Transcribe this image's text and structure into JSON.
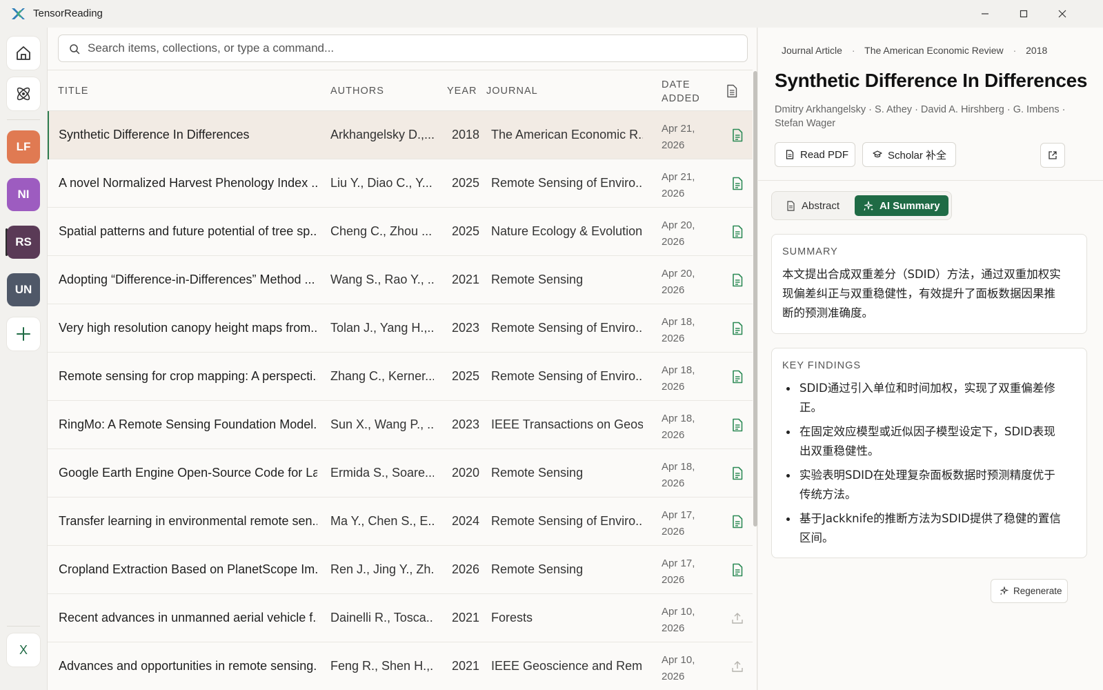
{
  "app": {
    "title": "TensorReading"
  },
  "window_controls": {
    "minimize": "minimize-icon",
    "maximize": "maximize-icon",
    "close": "close-icon"
  },
  "rail": {
    "home_icon": "home-icon",
    "atom_icon": "atom-icon",
    "libraries": [
      {
        "initials": "LF",
        "color": "#e07a52"
      },
      {
        "initials": "NI",
        "color": "#9d5cc0"
      },
      {
        "initials": "RS",
        "color": "#5a3a56",
        "active": true
      },
      {
        "initials": "UN",
        "color": "#4f5868"
      }
    ],
    "add_icon": "plus-icon",
    "bottom_label": "X"
  },
  "search": {
    "placeholder": "Search items, collections, or type a command..."
  },
  "table": {
    "headers": {
      "title": "TITLE",
      "authors": "AUTHORS",
      "year": "YEAR",
      "journal": "JOURNAL",
      "date_added_1": "DATE",
      "date_added_2": "ADDED"
    },
    "rows": [
      {
        "title": "Synthetic Difference In Differences",
        "authors": "Arkhangelsky D.,...",
        "year": "2018",
        "journal": "The American Economic R...",
        "date1": "Apr 21,",
        "date2": "2026",
        "has_pdf": true,
        "selected": true
      },
      {
        "title": "A novel Normalized Harvest Phenology Index ...",
        "authors": "Liu Y., Diao C., Y...",
        "year": "2025",
        "journal": "Remote Sensing of Enviro...",
        "date1": "Apr 21,",
        "date2": "2026",
        "has_pdf": true
      },
      {
        "title": "Spatial patterns and future potential of tree sp...",
        "authors": "Cheng C., Zhou ...",
        "year": "2025",
        "journal": "Nature Ecology & Evolution",
        "date1": "Apr 20,",
        "date2": "2026",
        "has_pdf": true
      },
      {
        "title": "Adopting “Difference-in-Differences” Method ...",
        "authors": "Wang S., Rao Y., ...",
        "year": "2021",
        "journal": "Remote Sensing",
        "date1": "Apr 20,",
        "date2": "2026",
        "has_pdf": true
      },
      {
        "title": "Very high resolution canopy height maps from...",
        "authors": "Tolan J., Yang H.,...",
        "year": "2023",
        "journal": "Remote Sensing of Enviro...",
        "date1": "Apr 18,",
        "date2": "2026",
        "has_pdf": true
      },
      {
        "title": "Remote sensing for crop mapping: A perspecti...",
        "authors": "Zhang C., Kerner...",
        "year": "2025",
        "journal": "Remote Sensing of Enviro...",
        "date1": "Apr 18,",
        "date2": "2026",
        "has_pdf": true
      },
      {
        "title": "RingMo: A Remote Sensing Foundation Model...",
        "authors": "Sun X., Wang P., ...",
        "year": "2023",
        "journal": "IEEE Transactions on Geos...",
        "date1": "Apr 18,",
        "date2": "2026",
        "has_pdf": true
      },
      {
        "title": "Google Earth Engine Open-Source Code for La...",
        "authors": "Ermida S., Soare...",
        "year": "2020",
        "journal": "Remote Sensing",
        "date1": "Apr 18,",
        "date2": "2026",
        "has_pdf": true
      },
      {
        "title": "Transfer learning in environmental remote sen...",
        "authors": "Ma Y., Chen S., E...",
        "year": "2024",
        "journal": "Remote Sensing of Enviro...",
        "date1": "Apr 17,",
        "date2": "2026",
        "has_pdf": true
      },
      {
        "title": "Cropland Extraction Based on PlanetScope Im...",
        "authors": "Ren J., Jing Y., Zh...",
        "year": "2026",
        "journal": "Remote Sensing",
        "date1": "Apr 17,",
        "date2": "2026",
        "has_pdf": true
      },
      {
        "title": "Recent advances in unmanned aerial vehicle f...",
        "authors": "Dainelli R., Tosca...",
        "year": "2021",
        "journal": "Forests",
        "date1": "Apr 10,",
        "date2": "2026",
        "has_pdf": false
      },
      {
        "title": "Advances and opportunities in remote sensing...",
        "authors": "Feng R., Shen H.,...",
        "year": "2021",
        "journal": "IEEE Geoscience and Rem...",
        "date1": "Apr 10,",
        "date2": "2026",
        "has_pdf": false
      }
    ]
  },
  "detail": {
    "type": "Journal Article",
    "journal": "The American Economic Review",
    "year": "2018",
    "title": "Synthetic Difference In Differences",
    "authors": "Dmitry Arkhangelsky · S. Athey · David A. Hirshberg · G. Imbens · Stefan Wager",
    "read_pdf": "Read PDF",
    "scholar": "Scholar 补全",
    "tabs": {
      "abstract": "Abstract",
      "ai_summary": "AI Summary"
    },
    "summary_label": "SUMMARY",
    "summary_text": "本文提出合成双重差分（SDID）方法，通过双重加权实现偏差纠正与双重稳健性，有效提升了面板数据因果推断的预测准确度。",
    "findings_label": "KEY FINDINGS",
    "findings": [
      "SDID通过引入单位和时间加权，实现了双重偏差修正。",
      "在固定效应模型或近似因子模型设定下，SDID表现出双重稳健性。",
      "实验表明SDID在处理复杂面板数据时预测精度优于传统方法。",
      "基于Jackknife的推断方法为SDID提供了稳健的置信区间。"
    ],
    "regenerate": "Regenerate"
  },
  "colors": {
    "accent": "#1f6b45",
    "selected_row": "#f2ebe4",
    "pdf_icon": "#2e8b57"
  }
}
